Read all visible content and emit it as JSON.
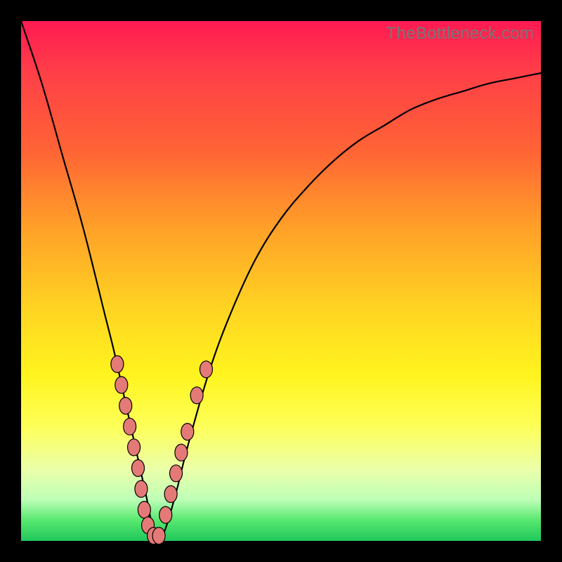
{
  "watermark": "TheBottleneck.com",
  "chart_data": {
    "type": "line",
    "title": "",
    "xlabel": "",
    "ylabel": "",
    "xlim": [
      0,
      100
    ],
    "ylim": [
      0,
      100
    ],
    "grid": false,
    "legend": false,
    "background": "rainbow-vertical-gradient",
    "series": [
      {
        "name": "bottleneck-curve",
        "x": [
          0,
          4,
          8,
          12,
          16,
          18,
          20,
          22,
          24,
          25,
          26,
          27,
          28,
          30,
          32,
          36,
          40,
          45,
          50,
          55,
          60,
          65,
          70,
          75,
          80,
          85,
          90,
          95,
          100
        ],
        "y": [
          100,
          88,
          74,
          60,
          44,
          36,
          27,
          18,
          9,
          4,
          1,
          1,
          3,
          10,
          18,
          32,
          43,
          54,
          62,
          68,
          73,
          77,
          80,
          83,
          85,
          86.5,
          88,
          89,
          90
        ]
      }
    ],
    "markers": {
      "name": "highlighted-points",
      "color": "#e47a77",
      "x": [
        18.5,
        19.3,
        20.1,
        20.9,
        21.7,
        22.5,
        23.1,
        23.7,
        24.4,
        25.5,
        26.5,
        27.8,
        28.8,
        29.8,
        30.8,
        32.0,
        33.8,
        35.6
      ],
      "y": [
        34,
        30,
        26,
        22,
        18,
        14,
        10,
        6,
        3,
        1,
        1,
        5,
        9,
        13,
        17,
        21,
        28,
        33
      ]
    }
  }
}
